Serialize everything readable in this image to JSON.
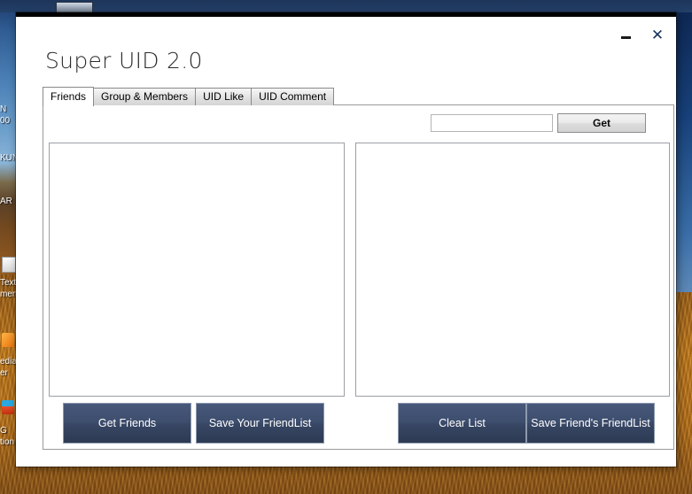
{
  "window": {
    "title": "Super UID 2.0",
    "controls": {
      "minimize_label": "–",
      "close_label": "✕"
    }
  },
  "tabs": [
    {
      "label": "Friends",
      "active": true
    },
    {
      "label": "Group & Members",
      "active": false
    },
    {
      "label": "UID Like",
      "active": false
    },
    {
      "label": "UID Comment",
      "active": false
    }
  ],
  "friends_tab": {
    "uid_input": {
      "value": "",
      "placeholder": ""
    },
    "get_button_label": "Get",
    "left_list": {
      "items": []
    },
    "right_list": {
      "items": []
    },
    "buttons": {
      "get_friends": "Get Friends",
      "save_your_friendlist": "Save Your FriendList",
      "clear_list": "Clear List",
      "save_friends_friendlist": "Save Friend's FriendList"
    }
  },
  "desktop": {
    "icon_labels": [
      "N",
      "00",
      "KUN",
      "AR",
      "Text",
      "men",
      "edia",
      "er",
      "G",
      "tion"
    ]
  },
  "colors": {
    "button_navy": "#3e4e6e",
    "button_navy_dark": "#2c3a53",
    "button_border": "#8e99ad",
    "window_bg": "#ffffff",
    "tab_inactive": "#e2e2e2",
    "listbox_border": "#9b9fa8",
    "close_icon": "#17335e",
    "desktop_sky": "#4a7fb5",
    "desktop_straw": "#c37d1e"
  }
}
